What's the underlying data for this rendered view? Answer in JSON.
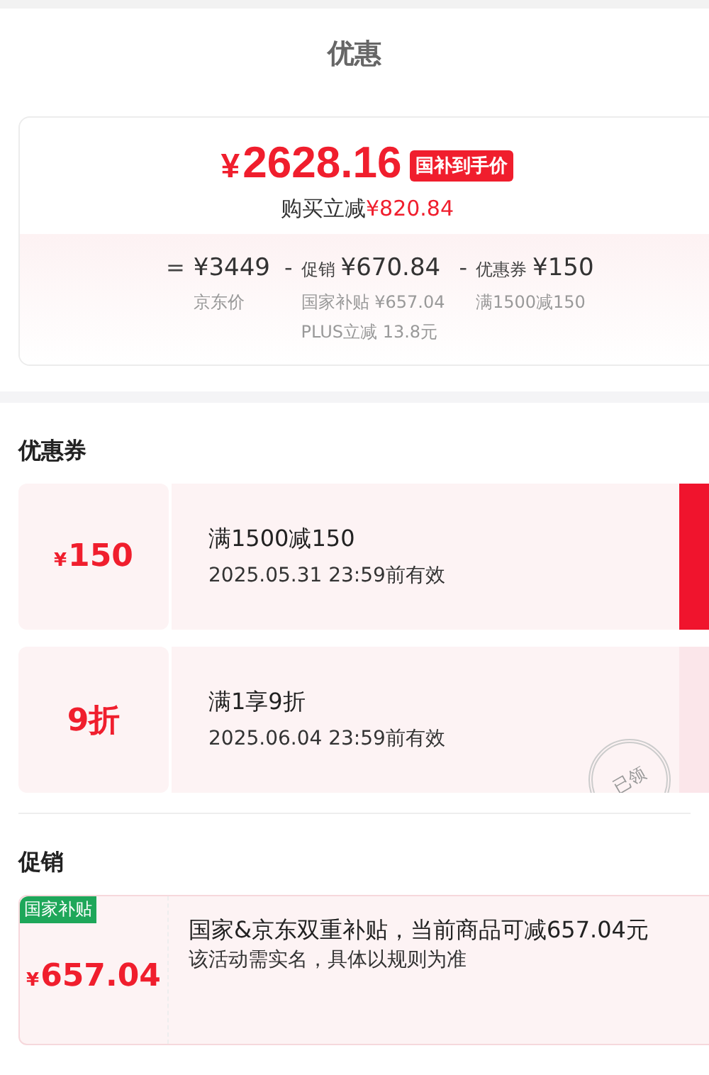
{
  "header": {
    "title": "优惠"
  },
  "price_card": {
    "symbol": "¥",
    "final_price": "2628.16",
    "badge": "国补到手价",
    "saving_label": "购买立减",
    "saving_amount": "¥820.84",
    "breakdown": [
      {
        "sign": "=",
        "amount": "¥3449",
        "notes": [
          "京东价"
        ]
      },
      {
        "sign": "-",
        "label": "促销",
        "amount": "¥670.84",
        "notes": [
          "国家补贴 ¥657.04",
          "PLUS立减 13.8元"
        ]
      },
      {
        "sign": "-",
        "label": "优惠券",
        "amount": "¥150",
        "notes": [
          "满1500减150"
        ]
      }
    ]
  },
  "coupons": {
    "title": "优惠券",
    "items": [
      {
        "symbol": "¥",
        "value": "150",
        "title": "满1500减150",
        "validity": "2025.05.31 23:59前有效",
        "claimed": false
      },
      {
        "value": "9折",
        "title": "满1享9折",
        "validity": "2025.06.04 23:59前有效",
        "claimed": true,
        "stamp": "已领"
      }
    ]
  },
  "promotions": {
    "title": "促销",
    "items": [
      {
        "tag": "国家补贴",
        "symbol": "¥",
        "amount": "657.04",
        "description": "国家&京东双重补贴，当前商品可减657.04元",
        "note": "该活动需实名，具体以规则为准"
      }
    ]
  }
}
